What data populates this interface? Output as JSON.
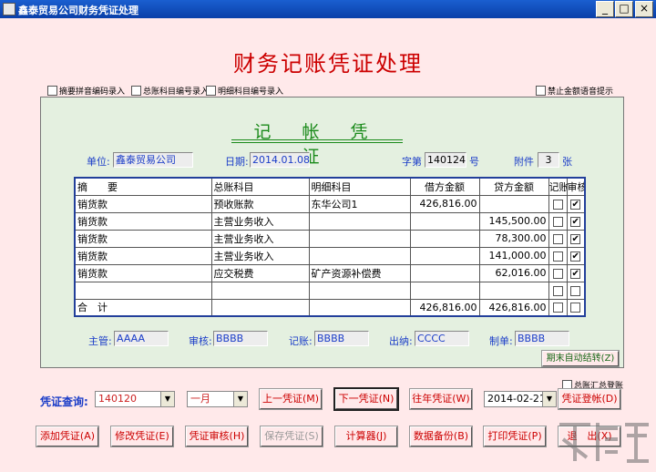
{
  "window": {
    "title": "鑫泰贸易公司财务凭证处理",
    "min": "_",
    "max": "□",
    "close": "×"
  },
  "main_title": "财务记账凭证处理",
  "options": {
    "pinyin": "摘要拼音编码录入",
    "general": "总账科目编号录入",
    "detail": "明细科目编号录入",
    "voice": "禁止金额语音提示"
  },
  "voucher": {
    "title": "记 帐 凭 证",
    "unit_label": "单位:",
    "unit": "鑫泰贸易公司",
    "date_label": "日期:",
    "date": "2014.01.08",
    "word_label": "字第",
    "word_no": "140124",
    "no_label": "号",
    "attach_label": "附件",
    "attach": "3",
    "attach_unit": "张"
  },
  "table": {
    "headers": [
      "摘　　要",
      "总账科目",
      "明细科目",
      "借方金额",
      "贷方金额",
      "记账",
      "审核"
    ],
    "rows": [
      {
        "summary": "销货款",
        "general": "预收账款",
        "detail": "东华公司1",
        "debit": "426,816.00",
        "credit": "",
        "posted": false,
        "audited": true
      },
      {
        "summary": "销货款",
        "general": "主营业务收入",
        "detail": "",
        "debit": "",
        "credit": "145,500.00",
        "posted": false,
        "audited": true
      },
      {
        "summary": "销货款",
        "general": "主营业务收入",
        "detail": "",
        "debit": "",
        "credit": "78,300.00",
        "posted": false,
        "audited": true
      },
      {
        "summary": "销货款",
        "general": "主营业务收入",
        "detail": "",
        "debit": "",
        "credit": "141,000.00",
        "posted": false,
        "audited": true
      },
      {
        "summary": "销货款",
        "general": "应交税费",
        "detail": "矿产资源补偿费",
        "debit": "",
        "credit": "62,016.00",
        "posted": false,
        "audited": true
      },
      {
        "summary": "",
        "general": "",
        "detail": "",
        "debit": "",
        "credit": "",
        "posted": false,
        "audited": false
      }
    ],
    "total": {
      "label": "合　计",
      "debit": "426,816.00",
      "credit": "426,816.00",
      "posted": false,
      "audited": false
    }
  },
  "signatures": {
    "supervisor_label": "主管:",
    "supervisor": "AAAA",
    "auditor_label": "审核:",
    "auditor": "BBBB",
    "bookkeeper_label": "记账:",
    "bookkeeper": "BBBB",
    "cashier_label": "出纳:",
    "cashier": "CCCC",
    "maker_label": "制单:",
    "maker": "BBBB"
  },
  "period_end_button": "期末自动结转(Z)",
  "summary_post_label": "总账汇总登账",
  "query": {
    "label": "凭证查询:",
    "voucher_no": "140120",
    "month": "一月",
    "prev": "上一凭证(M)",
    "next": "下一凭证(N)",
    "prev_year": "往年凭证(W)",
    "date": "2014-02-21",
    "register": "凭证登帐(D)"
  },
  "actions": {
    "add": "添加凭证(A)",
    "edit": "修改凭证(E)",
    "audit": "凭证审核(H)",
    "save": "保存凭证(S)",
    "calc": "计算器(J)",
    "backup": "数据备份(B)",
    "print": "打印凭证(P)",
    "exit": "退　出(X)"
  },
  "colors": {
    "background": "#FFE9EA",
    "panel": "#E4F0E0",
    "title_red": "#CC0000",
    "voucher_green": "#1A8A1A",
    "label_blue": "#1A3CC8"
  }
}
